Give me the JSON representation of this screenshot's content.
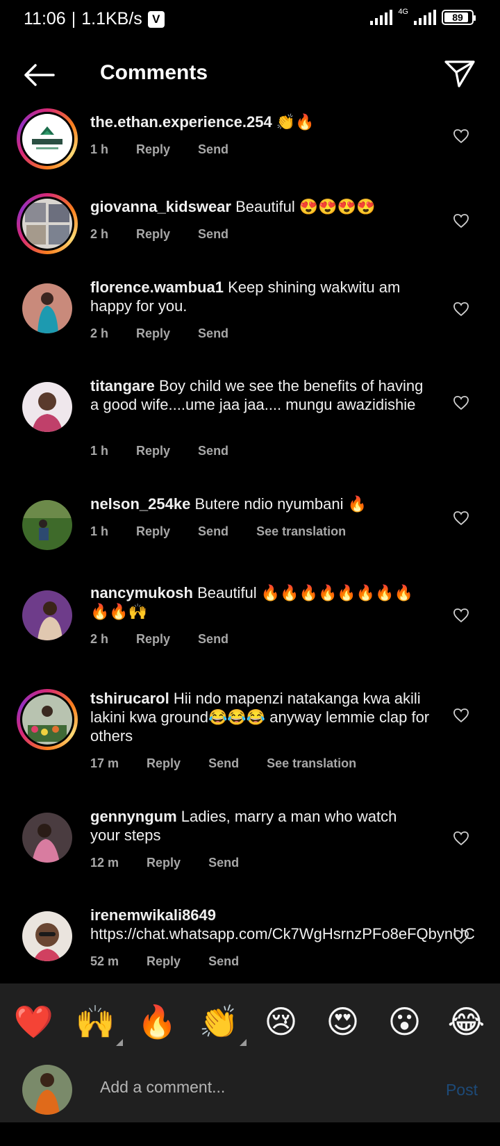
{
  "status_bar": {
    "time": "11:06",
    "speed": "1.1KB/s",
    "network": "4G",
    "battery": "89",
    "battery_level": 0.89
  },
  "header": {
    "title": "Comments",
    "back_icon": "arrow-left-icon",
    "share_icon": "paper-plane-icon"
  },
  "comments": [
    {
      "username": "the.ethan.experience.254",
      "text": "👏🔥",
      "time": "1 h",
      "reply": "Reply",
      "send": "Send"
    },
    {
      "username": "giovanna_kidswear",
      "text": "Beautiful 😍😍😍😍",
      "time": "2 h",
      "reply": "Reply",
      "send": "Send"
    },
    {
      "username": "florence.wambua1",
      "text": "Keep shining wakwitu am happy for you.",
      "time": "2 h",
      "reply": "Reply",
      "send": "Send"
    },
    {
      "username": "titangare",
      "text": "Boy child we see the benefits of having a good wife....ume jaa jaa.... mungu awazidishie",
      "time": "1 h",
      "reply": "Reply",
      "send": "Send"
    },
    {
      "username": "nelson_254ke",
      "text": "Butere ndio nyumbani 🔥",
      "time": "1 h",
      "reply": "Reply",
      "send": "Send",
      "translate": "See translation"
    },
    {
      "username": "nancymukosh",
      "text": "Beautiful 🔥🔥🔥🔥🔥🔥🔥🔥🔥🔥🙌",
      "time": "2 h",
      "reply": "Reply",
      "send": "Send"
    },
    {
      "username": "tshirucarol",
      "text": "Hii ndo mapenzi natakanga kwa akili lakini kwa ground😂😂😂 anyway lemmie clap for others",
      "time": "17 m",
      "reply": "Reply",
      "send": "Send",
      "translate": "See translation"
    },
    {
      "username": "gennyngum",
      "text": "Ladies, marry a man who watch your steps",
      "time": "12 m",
      "reply": "Reply",
      "send": "Send"
    },
    {
      "username": "irenemwikali8649",
      "text": "https://chat.whatsapp.com/Ck7WgHsrnzPFo8eFQbynUC",
      "time": "52 m",
      "reply": "Reply",
      "send": "Send"
    }
  ],
  "reactions": [
    "❤️",
    "🙌",
    "🔥",
    "👏",
    "😢",
    "😍",
    "😮",
    "😂"
  ],
  "composer": {
    "placeholder": "Add a comment...",
    "post_label": "Post"
  },
  "colors": {
    "background": "#000000",
    "secondary_text": "#a8a8a8",
    "bar_background": "#202020",
    "post_disabled": "#1d4a78"
  }
}
